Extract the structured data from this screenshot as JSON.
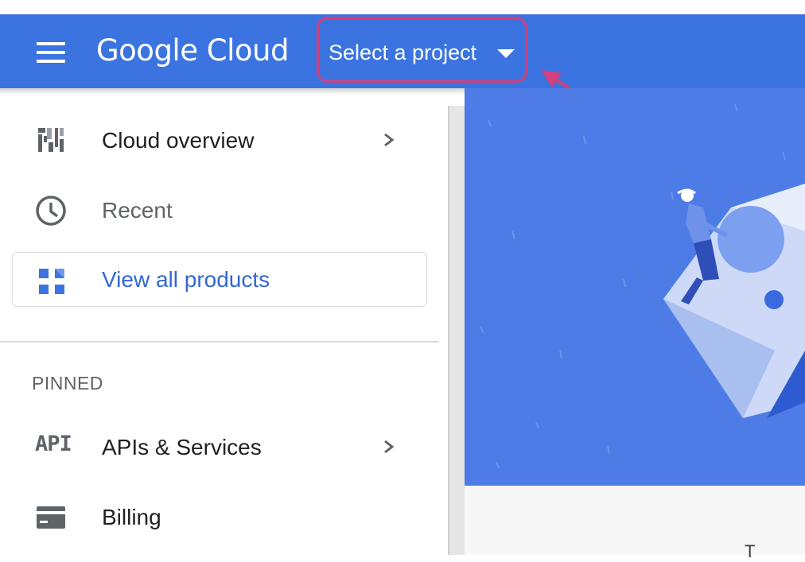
{
  "header": {
    "logo": "Google Cloud",
    "project_selector_label": "Select a project"
  },
  "sidebar": {
    "items": [
      {
        "label": "Cloud overview",
        "icon": "dashboard-icon",
        "has_chevron": true
      },
      {
        "label": "Recent",
        "icon": "clock-icon",
        "has_chevron": false
      }
    ],
    "view_all": {
      "label": "View all products",
      "icon": "grid-icon"
    },
    "pinned_title": "PINNED",
    "pinned": [
      {
        "label": "APIs & Services",
        "icon_text": "API",
        "has_chevron": true
      },
      {
        "label": "Billing",
        "icon": "billing-card-icon",
        "has_chevron": false
      }
    ]
  },
  "content": {
    "partial_text": "T"
  },
  "colors": {
    "header_blue": "#3b74e0",
    "highlight_pink": "#d13f7c",
    "link_blue": "#3367d6",
    "hero_blue": "#4d7ce6"
  }
}
